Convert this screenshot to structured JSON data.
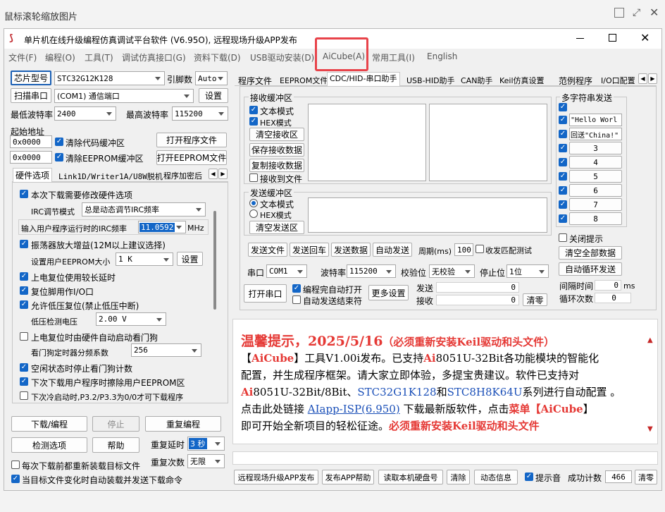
{
  "viewer": {
    "title": "鼠标滚轮缩放图片"
  },
  "app": {
    "title": "单片机在线升级编程仿真调试平台软件 (V6.95O), 远程现场升级APP发布"
  },
  "menu": [
    "文件(F)",
    "编程(O)",
    "工具(T)",
    "调试仿真接口(G)",
    "资料下载(D)",
    "USB驱动安装(D)",
    "AiCube(A)",
    "常用工具(I)",
    "English"
  ],
  "left": {
    "chip_label": "芯片型号",
    "chip_value": "STC32G12K128",
    "pin_label": "引脚数",
    "pin_value": "Auto",
    "scan_label": "扫描串口",
    "port_value": "(COM1) 通信端口",
    "settings_label": "设置",
    "minbaud_label": "最低波特率",
    "minbaud_value": "2400",
    "maxbaud_label": "最高波特率",
    "maxbaud_value": "115200",
    "start_addr_label": "起始地址",
    "addr1": "0x0000",
    "addr2": "0x0000",
    "clear_code_label": "清除代码缓冲区",
    "clear_eeprom_label": "清除EEPROM缓冲区",
    "open_prog_label": "打开程序文件",
    "open_eeprom_label": "打开EEPROM文件",
    "tabs": [
      "硬件选项",
      "Link1D/Writer1A/U8W脱机",
      "程序加密后"
    ],
    "options": {
      "opt1": "本次下载需要修改硬件选项",
      "irc_mode_label": "IRC调节模式",
      "irc_mode_value": "总是动态调节IRC频率",
      "irc_freq_label": "输入用户程序运行时的IRC频率",
      "irc_freq_value": "11.0592",
      "irc_freq_unit": "MHz",
      "opt_osc": "振荡器放大增益(12M以上建议选择)",
      "eeprom_size_label": "设置用户EEPROM大小",
      "eeprom_size_value": "1   K",
      "eeprom_set_label": "设置",
      "opt_por": "上电复位使用较长延时",
      "opt_reset_io": "复位脚用作I/O口",
      "opt_lvr": "允许低压复位(禁止低压中断)",
      "lvd_label": "低压检测电压",
      "lvd_value": "2.00 V",
      "opt_wdt": "上电复位时由硬件自动启动看门狗",
      "wdt_div_label": "看门狗定时器分频系数",
      "wdt_div_value": "256",
      "opt_idle_wdt": "空闲状态时停止看门狗计数",
      "opt_erase_eeprom": "下次下载用户程序时擦除用户EEPROM区",
      "opt_next_boot": "下次冷启动时,P3.2/P3.3为0/0才可下载程序"
    },
    "download_label": "下载/编程",
    "stop_label": "停止",
    "reprogram_label": "重复编程",
    "check_label": "检测选项",
    "help_label": "帮助",
    "repeat_delay_label": "重复延时",
    "repeat_delay_value": "3 秒",
    "repeat_count_label": "重复次数",
    "repeat_count_value": "无限",
    "reload_each_label": "每次下载前都重新装载目标文件",
    "auto_reload_label": "当目标文件变化时自动装载并发送下载命令"
  },
  "right_tabs": [
    "程序文件",
    "EEPROM文件",
    "CDC/HID-串口助手",
    "USB-HID助手",
    "CAN助手",
    "Keil仿真设置",
    "范例程序",
    "I/O口配置"
  ],
  "serial": {
    "recv_buffer": "接收缓冲区",
    "text_mode": "文本模式",
    "hex_mode": "HEX模式",
    "clear_recv": "清空接收区",
    "save_recv": "保存接收数据",
    "copy_recv": "复制接收数据",
    "recv_to_file": "接收到文件",
    "send_buffer": "发送缓冲区",
    "send_text_mode": "文本模式",
    "send_hex_mode": "HEX模式",
    "clear_send": "清空发送区",
    "send_file": "发送文件",
    "send_return": "发送回车",
    "send_data": "发送数据",
    "auto_send": "自动发送",
    "period_label": "周期(ms)",
    "period_value": "100",
    "match_label": "收发匹配测试",
    "port_label": "串口",
    "port_value": "COM1",
    "baud_label": "波特率",
    "baud_value": "115200",
    "parity_label": "校验位",
    "parity_value": "无校验",
    "stop_label": "停止位",
    "stop_value": "1位",
    "open_port": "打开串口",
    "auto_open": "编程完自动打开",
    "auto_close": "自动发送结束符",
    "more_settings": "更多设置",
    "sent_label": "发送",
    "sent_value": "0",
    "recv_label": "接收",
    "recv_value": "0",
    "clear_label": "清零"
  },
  "multi": {
    "title": "多字符串发送",
    "items": [
      "\"Hello Worl",
      "回送\"China!\"",
      "3",
      "4",
      "5",
      "6",
      "7",
      "8"
    ],
    "close_tip": "关闭提示",
    "clear_all": "清空全部数据",
    "auto_loop": "自动循环发送",
    "interval_label": "间隔时间",
    "interval_value": "0",
    "interval_unit": "ms",
    "loop_label": "循环次数",
    "loop_value": "0"
  },
  "notice": {
    "headline": "温馨提示，2025/5/16",
    "headline_sub": "（必须重新安装Keil驱动和头文件）",
    "l1_pre": "【",
    "l1_brand": "AiCube",
    "l1_post": "】工具V1.00i发布。已支持",
    "l1_ai": "Ai",
    "l1_chip": "8051U-32Bit各功能模块的智能化",
    "l2": "配置，并生成程序框架。请大家立即体验，多提宝贵建议。软件已支持对",
    "l3_ai": "Ai",
    "l3_a": "8051U-32Bit/8Bit、",
    "l3_b": "STC32G1K128",
    "l3_c": "和",
    "l3_d": "STC8H8K64U",
    "l3_e": "系列进行自动配置 。",
    "l4_a": "点击此处链接 ",
    "l4_link": "AIapp-ISP(6.950)",
    "l4_b": " 下载最新版软件，点击",
    "l4_menu": "菜单【",
    "l4_brand": "AiCube",
    "l4_c": "】",
    "l5_a": "即可开始全新项目的轻松征途。",
    "l5_b": "必须重新安装Keil驱动和头文件"
  },
  "bottom": {
    "b1": "远程现场升级APP发布",
    "b2": "发布APP帮助",
    "b3": "读取本机硬盘号",
    "b4": "清除",
    "b5": "动态信息",
    "sound": "提示音",
    "count_label": "成功计数",
    "count_value": "466",
    "clear": "清零"
  }
}
